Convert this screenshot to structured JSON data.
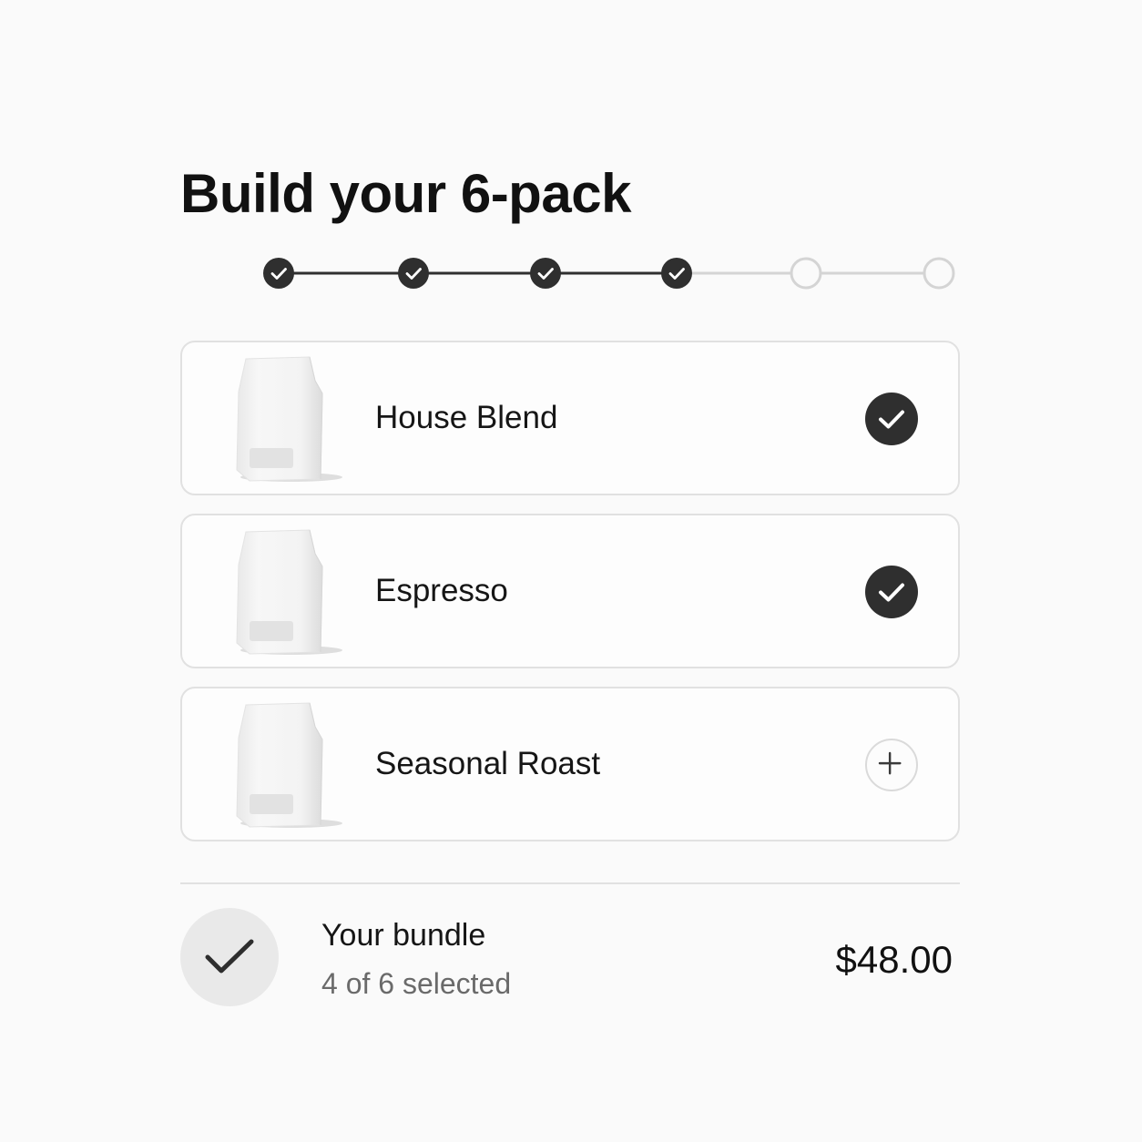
{
  "page": {
    "title": "Build your 6-pack"
  },
  "stepper": {
    "total_steps": 6,
    "completed_steps": 4
  },
  "products": [
    {
      "name": "House Blend",
      "selected": true,
      "image_icon": "coffee-bag-icon",
      "toggle_icon": "checkmark-icon"
    },
    {
      "name": "Espresso",
      "selected": true,
      "image_icon": "coffee-bag-icon",
      "toggle_icon": "checkmark-icon"
    },
    {
      "name": "Seasonal Roast",
      "selected": false,
      "image_icon": "coffee-bag-icon",
      "toggle_icon": "plus-icon"
    }
  ],
  "bundle": {
    "title": "Your bundle",
    "count_text": "4 of 6 selected",
    "price": "$48.00",
    "icon": "checkmark-icon"
  },
  "colors": {
    "background": "#fafafa",
    "step_complete": "#2f2f2f",
    "step_incomplete": "#d4d4d4",
    "card_border": "#e1e1e1",
    "badge_background": "#e9e9e9",
    "muted_text": "#6a6a6a"
  }
}
